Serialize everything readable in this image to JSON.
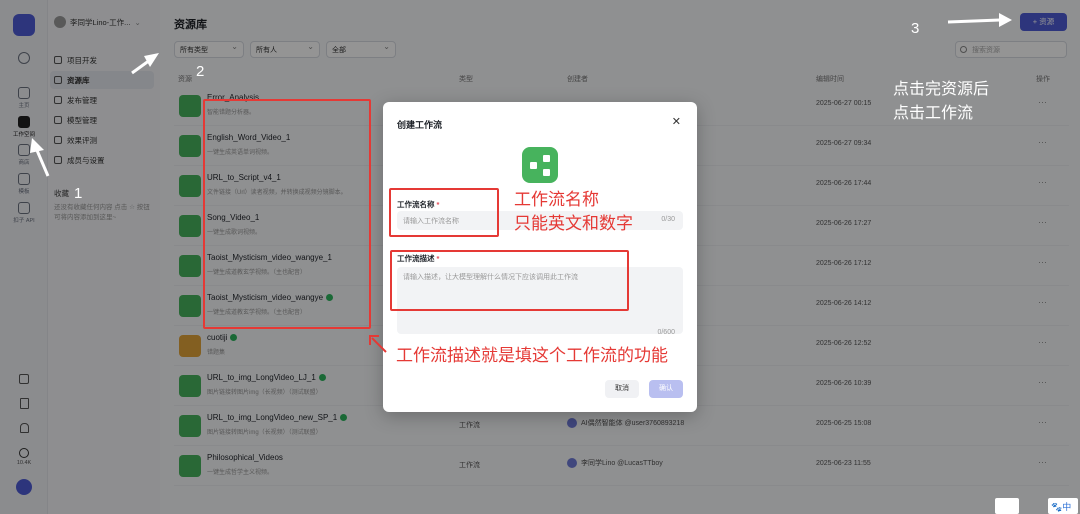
{
  "rail": {
    "items": [
      {
        "label": "主页",
        "active": false
      },
      {
        "label": "工作空间",
        "active": true
      },
      {
        "label": "商店",
        "active": false
      },
      {
        "label": "模板",
        "active": false
      },
      {
        "label": "扣子 API",
        "active": false
      }
    ],
    "points": "10.4K"
  },
  "sidebar": {
    "workspace": "李同学Lino-工作...",
    "nav": [
      {
        "label": "项目开发",
        "active": false
      },
      {
        "label": "资源库",
        "active": true
      },
      {
        "label": "发布管理",
        "active": false
      },
      {
        "label": "模型管理",
        "active": false
      },
      {
        "label": "效果评测",
        "active": false
      },
      {
        "label": "成员与设置",
        "active": false
      }
    ],
    "favorites_title": "收藏",
    "favorites_tip": "还没有收藏任何内容 点击 ☆ 按钮可将内容添加到这里~"
  },
  "main": {
    "title": "资源库",
    "filters": [
      "所有类型",
      "所有人",
      "全部"
    ],
    "search_placeholder": "搜索资源",
    "add_button": "+ 资源",
    "columns": {
      "name": "资源",
      "type": "类型",
      "creator": "创建者",
      "time": "编辑时间",
      "actions": "操作"
    },
    "rows": [
      {
        "name": "Error_Analysis",
        "desc": "智能错题分析器。",
        "type": "",
        "owner": "",
        "time": "2025-06-27 00:15",
        "verified": false,
        "db": false
      },
      {
        "name": "English_Word_Video_1",
        "desc": "一键生成英语单词视频。",
        "type": "",
        "owner": "",
        "time": "2025-06-27 09:34",
        "verified": false,
        "db": false
      },
      {
        "name": "URL_to_Script_v4_1",
        "desc": "文件链接（Url）读者视频，并转换成视频分镜脚本。",
        "type": "",
        "owner": "",
        "time": "2025-06-26 17:44",
        "verified": false,
        "db": false
      },
      {
        "name": "Song_Video_1",
        "desc": "一键生成歌词视频。",
        "type": "",
        "owner": "",
        "time": "2025-06-26 17:27",
        "verified": false,
        "db": false
      },
      {
        "name": "Taoist_Mysticism_video_wangye_1",
        "desc": "一键生成道教玄学视频。（主也配音）",
        "type": "",
        "owner": "",
        "time": "2025-06-26 17:12",
        "verified": false,
        "db": false
      },
      {
        "name": "Taoist_Mysticism_video_wangye",
        "desc": "一键生成道教玄学视频。（主也配音）",
        "type": "",
        "owner": "",
        "time": "2025-06-26 14:12",
        "verified": true,
        "db": false
      },
      {
        "name": "cuotiji",
        "desc": "错题集",
        "type": "",
        "owner": "",
        "time": "2025-06-26 12:52",
        "verified": true,
        "db": true
      },
      {
        "name": "URL_to_img_LongVideo_LJ_1",
        "desc": "图片链接转图片img（长视频）（测试联盟）",
        "type": "",
        "owner": "",
        "time": "2025-06-26 10:39",
        "verified": true,
        "db": false
      },
      {
        "name": "URL_to_img_LongVideo_new_SP_1",
        "desc": "图片链接转图片img（长视频）（测试联盟）",
        "type": "工作流",
        "owner": "AI偶然智能体 @user3760893218",
        "time": "2025-06-25 15:08",
        "verified": true,
        "db": false
      },
      {
        "name": "Philosophical_Videos",
        "desc": "一键生成哲学主义视频。",
        "type": "工作流",
        "owner": "李同学Lino @LucasTTboy",
        "time": "2025-06-23 11:55",
        "verified": false,
        "db": false
      }
    ]
  },
  "modal": {
    "title": "创建工作流",
    "name_label": "工作流名称",
    "name_placeholder": "请输入工作流名称",
    "name_count": "0/30",
    "desc_label": "工作流描述",
    "desc_placeholder": "请输入描述，让大模型理解什么情况下应该调用此工作流",
    "desc_count": "0/600",
    "required_mark": "*",
    "cancel": "取消",
    "confirm": "确认"
  },
  "annotations": {
    "num1": "1",
    "num2": "2",
    "num3": "3",
    "tip_right_1": "点击完资源后",
    "tip_right_2": "点击工作流",
    "name_note_1": "工作流名称",
    "name_note_2": "只能英文和数字",
    "desc_note": "工作流描述就是填这个工作流的功能"
  },
  "corner": {
    "left": "",
    "right": "中"
  }
}
